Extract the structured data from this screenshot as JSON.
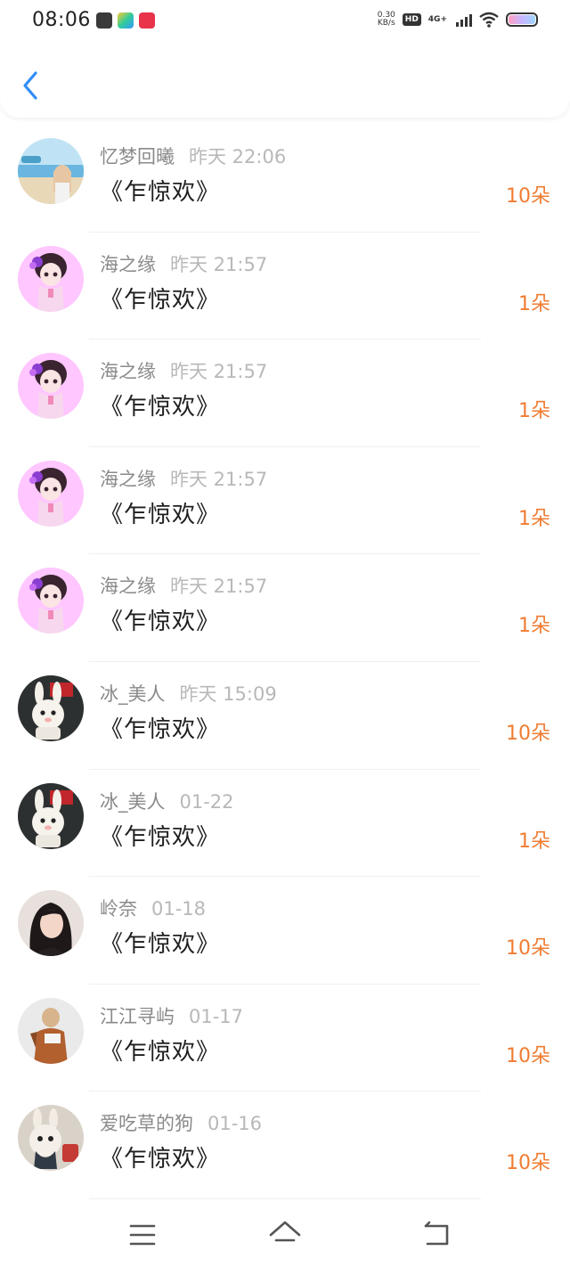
{
  "status_bar": {
    "time": "08:06",
    "net_speed_value": "0.30",
    "net_speed_unit": "KB/s",
    "hd_label": "HD",
    "signal_label": "4G+"
  },
  "header": {
    "back_icon": "chevron-left-icon",
    "accent_color": "#2f8ef7"
  },
  "gifts": [
    {
      "user": "忆梦回曦",
      "time": "昨天 22:06",
      "song": "《乍惊欢》",
      "count": "10朵",
      "avatar": "beach"
    },
    {
      "user": "海之缘",
      "time": "昨天 21:57",
      "song": "《乍惊欢》",
      "count": "1朵",
      "avatar": "anime-girl"
    },
    {
      "user": "海之缘",
      "time": "昨天 21:57",
      "song": "《乍惊欢》",
      "count": "1朵",
      "avatar": "anime-girl"
    },
    {
      "user": "海之缘",
      "time": "昨天 21:57",
      "song": "《乍惊欢》",
      "count": "1朵",
      "avatar": "anime-girl"
    },
    {
      "user": "海之缘",
      "time": "昨天 21:57",
      "song": "《乍惊欢》",
      "count": "1朵",
      "avatar": "anime-girl"
    },
    {
      "user": "冰_美人",
      "time": "昨天 15:09",
      "song": "《乍惊欢》",
      "count": "10朵",
      "avatar": "bunny"
    },
    {
      "user": "冰_美人",
      "time": "01-22",
      "song": "《乍惊欢》",
      "count": "1朵",
      "avatar": "bunny"
    },
    {
      "user": "岭奈",
      "time": "01-18",
      "song": "《乍惊欢》",
      "count": "10朵",
      "avatar": "portrait"
    },
    {
      "user": "江江寻屿",
      "time": "01-17",
      "song": "《乍惊欢》",
      "count": "10朵",
      "avatar": "figure"
    },
    {
      "user": "爱吃草的狗",
      "time": "01-16",
      "song": "《乍惊欢》",
      "count": "10朵",
      "avatar": "plush"
    }
  ],
  "colors": {
    "count": "#f07c32",
    "name": "#8a8a8a",
    "time": "#b8b8b8"
  },
  "nav": {
    "menu_icon": "menu-icon",
    "home_icon": "home-icon",
    "back_icon": "back-icon"
  }
}
